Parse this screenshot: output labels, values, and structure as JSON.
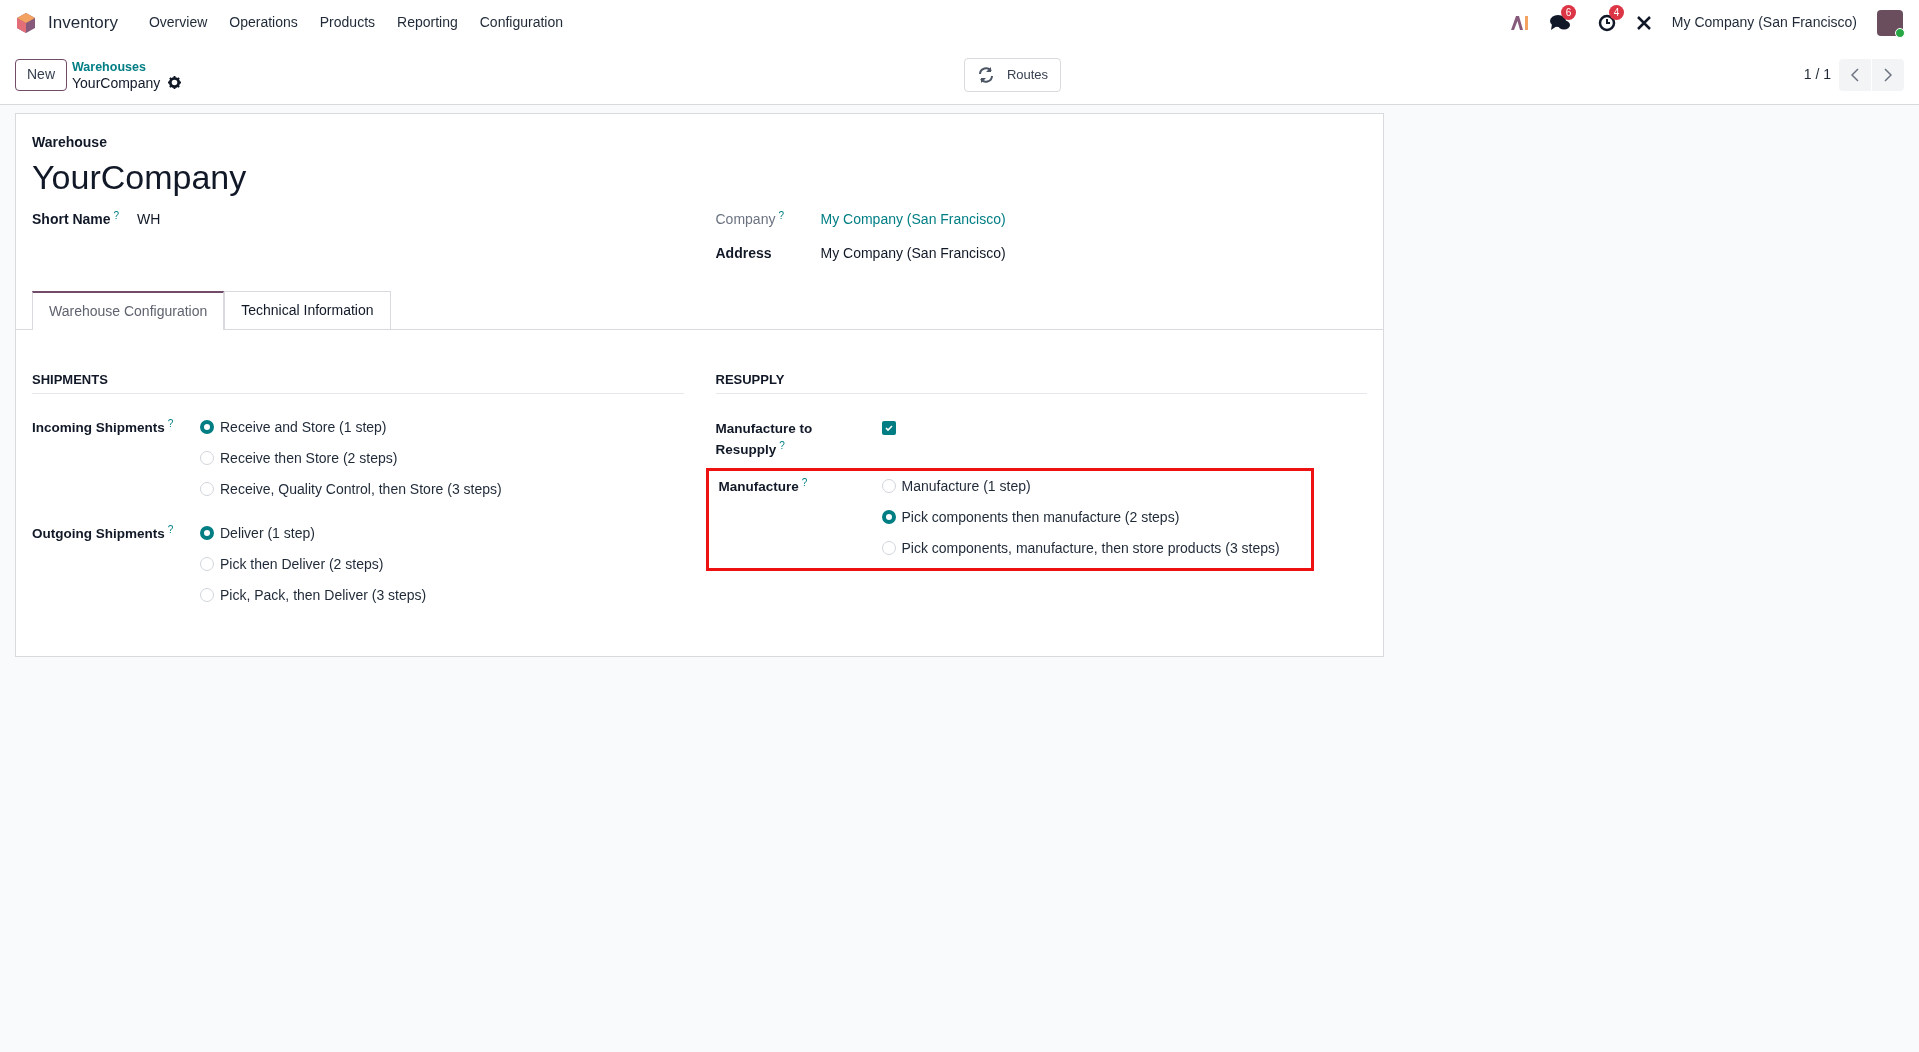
{
  "navbar": {
    "app_name": "Inventory",
    "menu": [
      "Overview",
      "Operations",
      "Products",
      "Reporting",
      "Configuration"
    ],
    "messages_badge": "6",
    "activities_badge": "4",
    "company": "My Company (San Francisco)"
  },
  "control_panel": {
    "new_button": "New",
    "breadcrumb_parent": "Warehouses",
    "breadcrumb_current": "YourCompany",
    "routes_button": "Routes",
    "pager": "1 / 1"
  },
  "form": {
    "title_label": "Warehouse",
    "title": "YourCompany",
    "left_fields": [
      {
        "label": "Short Name",
        "help": "?",
        "value": "WH",
        "kind": "text"
      }
    ],
    "right_fields": [
      {
        "label": "Company",
        "help": "?",
        "value": "My Company (San Francisco)",
        "kind": "link"
      },
      {
        "label": "Address",
        "value": "My Company (San Francisco)",
        "kind": "text"
      }
    ],
    "tabs": [
      {
        "label": "Warehouse Configuration",
        "selected": true
      },
      {
        "label": "Technical Information",
        "selected": false
      }
    ],
    "shipments": {
      "heading": "SHIPMENTS",
      "groups": [
        {
          "label": "Incoming Shipments",
          "help": "?",
          "options": [
            {
              "label": "Receive and Store (1 step)",
              "selected": true
            },
            {
              "label": "Receive then Store (2 steps)",
              "selected": false
            },
            {
              "label": "Receive, Quality Control, then Store (3 steps)",
              "selected": false
            }
          ]
        },
        {
          "label": "Outgoing Shipments",
          "help": "?",
          "options": [
            {
              "label": "Deliver (1 step)",
              "selected": true
            },
            {
              "label": "Pick then Deliver (2 steps)",
              "selected": false
            },
            {
              "label": "Pick, Pack, then Deliver (3 steps)",
              "selected": false
            }
          ]
        }
      ]
    },
    "resupply": {
      "heading": "RESUPPLY",
      "checkbox": {
        "label": "Manufacture to Resupply",
        "help": "?",
        "checked": true
      },
      "manufacture": {
        "label": "Manufacture",
        "help": "?",
        "highlighted": true,
        "options": [
          {
            "label": "Manufacture (1 step)",
            "selected": false
          },
          {
            "label": "Pick components then manufacture (2 steps)",
            "selected": true
          },
          {
            "label": "Pick components, manufacture, then store products (3 steps)",
            "selected": false
          }
        ]
      }
    }
  }
}
